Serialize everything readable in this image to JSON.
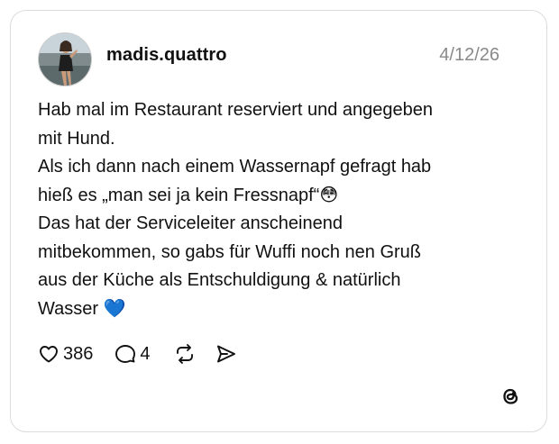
{
  "post": {
    "username": "madis.quattro",
    "date": "4/12/26",
    "text": "Hab mal im Restaurant reserviert und angegeben\nmit Hund.\nAls ich dann nach einem Wassernapf gefragt hab\nhieß es „man sei ja kein Fressnapf“😳\nDas hat der Serviceleiter anscheinend\nmitbekommen, so gabs für Wuffi noch nen Gruß\naus der Küche als Entschuldigung & natürlich\nWasser 💙",
    "likes": "386",
    "replies": "4"
  },
  "icons": {
    "like": "heart-icon",
    "reply": "comment-bubble-icon",
    "repost": "repost-arrows-icon",
    "share": "send-icon",
    "brand": "threads-logo-icon"
  },
  "colors": {
    "border": "#dcdcdc",
    "text": "#111111",
    "date": "#8a8a8a"
  }
}
